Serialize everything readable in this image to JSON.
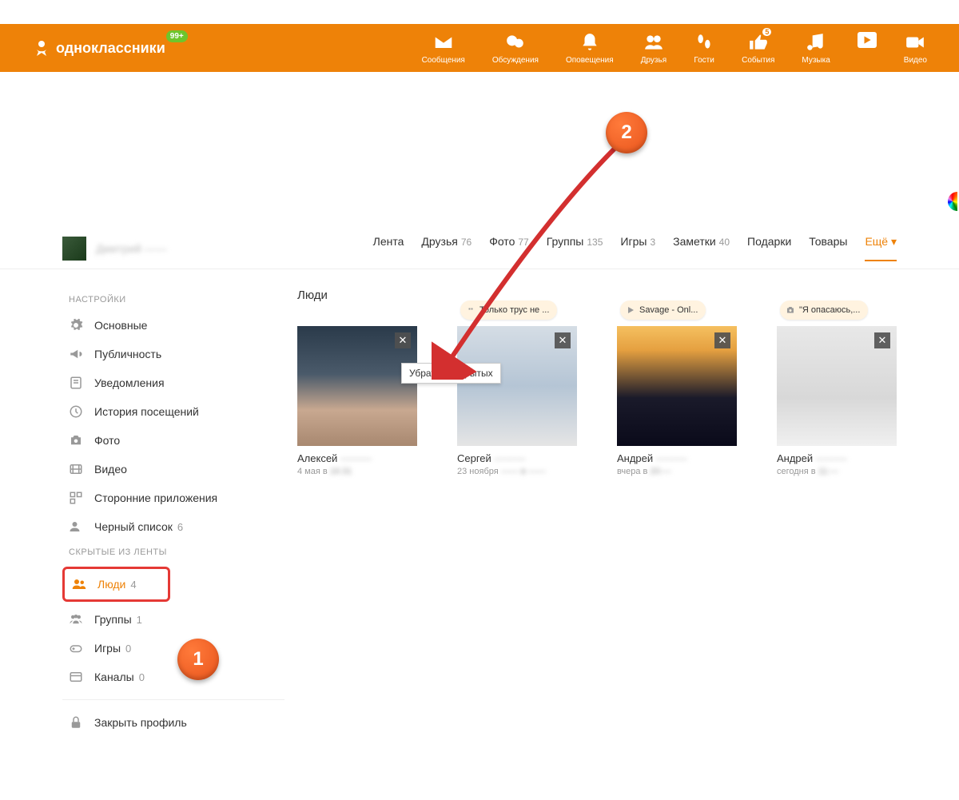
{
  "header": {
    "logo_text": "одноклассники",
    "badge": "99+",
    "items": [
      {
        "label": "Сообщения",
        "badge": ""
      },
      {
        "label": "Обсуждения",
        "badge": ""
      },
      {
        "label": "Оповещения",
        "badge": ""
      },
      {
        "label": "Друзья",
        "badge": ""
      },
      {
        "label": "Гости",
        "badge": ""
      },
      {
        "label": "События",
        "badge": "5"
      },
      {
        "label": "Музыка",
        "badge": ""
      },
      {
        "label": "Видео",
        "badge": ""
      }
    ]
  },
  "profile": {
    "username": "Дмитрий ——",
    "tabs": [
      {
        "label": "Лента",
        "count": ""
      },
      {
        "label": "Друзья",
        "count": "76"
      },
      {
        "label": "Фото",
        "count": "77"
      },
      {
        "label": "Группы",
        "count": "135"
      },
      {
        "label": "Игры",
        "count": "3"
      },
      {
        "label": "Заметки",
        "count": "40"
      },
      {
        "label": "Подарки",
        "count": ""
      },
      {
        "label": "Товары",
        "count": ""
      },
      {
        "label": "Ещё ▾",
        "count": ""
      }
    ]
  },
  "sidebar": {
    "section1_title": "НАСТРОЙКИ",
    "items1": [
      {
        "label": "Основные"
      },
      {
        "label": "Публичность"
      },
      {
        "label": "Уведомления"
      },
      {
        "label": "История посещений"
      },
      {
        "label": "Фото"
      },
      {
        "label": "Видео"
      },
      {
        "label": "Сторонние приложения"
      },
      {
        "label": "Черный список",
        "count": "6"
      }
    ],
    "section2_title": "СКРЫТЫЕ ИЗ ЛЕНТЫ",
    "items2": [
      {
        "label": "Люди",
        "count": "4"
      },
      {
        "label": "Группы",
        "count": "1"
      },
      {
        "label": "Игры",
        "count": "0"
      },
      {
        "label": "Каналы",
        "count": "0"
      }
    ],
    "close_profile": "Закрыть профиль"
  },
  "main": {
    "title": "Люди",
    "tooltip": "Убрать из скрытых",
    "cards": [
      {
        "pill": "",
        "name_vis": "Алексей",
        "name_hidden": "———",
        "date_vis": "4 мая в",
        "date_hidden": "16:31"
      },
      {
        "pill": "Только трус не ...",
        "name_vis": "Сергей",
        "name_hidden": "———",
        "date_vis": "23 ноября",
        "date_hidden": "—— в ——"
      },
      {
        "pill": "Savage - Onl...",
        "name_vis": "Андрей",
        "name_hidden": "———",
        "date_vis": "вчера в",
        "date_hidden": "20:—"
      },
      {
        "pill": "\"Я опасаюсь,...",
        "name_vis": "Андрей",
        "name_hidden": "———",
        "date_vis": "сегодня в",
        "date_hidden": "11:—"
      }
    ]
  },
  "markers": {
    "m1": "1",
    "m2": "2"
  }
}
